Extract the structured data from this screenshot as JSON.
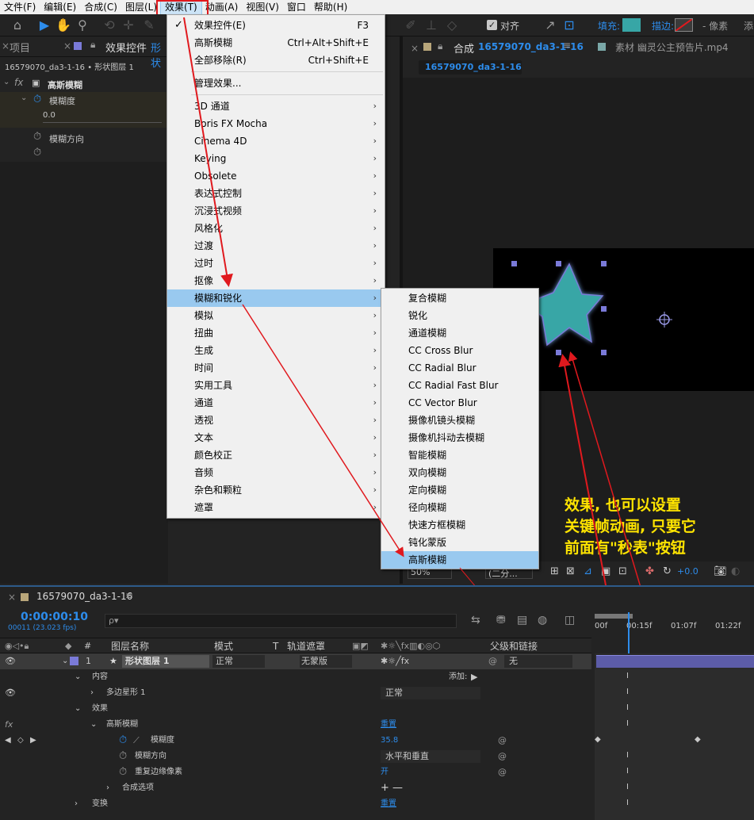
{
  "menubar": {
    "items": [
      "文件(F)",
      "编辑(E)",
      "合成(C)",
      "图层(L)",
      "效果(T)",
      "动画(A)",
      "视图(V)",
      "窗口",
      "帮助(H)"
    ]
  },
  "toolbar": {
    "align_label": "对齐",
    "fill_label": "填充:",
    "stroke_label": "描边:",
    "stroke_unit": "- 像素",
    "add_label": "添"
  },
  "left_panel": {
    "tab_project": "项目",
    "tab_effect_controls": "效果控件",
    "tab_layer": "形状",
    "breadcrumb": "16579070_da3-1-16 • 形状图层 1",
    "effect_name": "高斯模糊",
    "blurriness_label": "模糊度",
    "blurriness_value": "0.0",
    "dimension_label": "模糊方向"
  },
  "comp_panel": {
    "tab_label": "合成",
    "comp_name": "16579070_da3-1-16",
    "footage_tab": "素材 幽灵公主预告片.mp4",
    "sub_tab": "16579070_da3-1-16",
    "zoom": "50%",
    "resolution": "(二分...",
    "exposure": "+0.0"
  },
  "effect_menu": {
    "items": [
      {
        "label": "效果控件(E)",
        "shortcut": "F3",
        "checked": true
      },
      {
        "label": "高斯模糊",
        "shortcut": "Ctrl+Alt+Shift+E"
      },
      {
        "label": "全部移除(R)",
        "shortcut": "Ctrl+Shift+E"
      }
    ],
    "manage": "管理效果...",
    "categories": [
      "3D 通道",
      "Boris FX Mocha",
      "Cinema 4D",
      "Keying",
      "Obsolete",
      "表达式控制",
      "沉浸式视频",
      "风格化",
      "过渡",
      "过时",
      "抠像",
      "模糊和锐化",
      "模拟",
      "扭曲",
      "生成",
      "时间",
      "实用工具",
      "通道",
      "透视",
      "文本",
      "颜色校正",
      "音频",
      "杂色和颗粒",
      "遮罩"
    ]
  },
  "blur_submenu": {
    "items": [
      "复合模糊",
      "锐化",
      "通道模糊",
      "CC Cross Blur",
      "CC Radial Blur",
      "CC Radial Fast Blur",
      "CC Vector Blur",
      "摄像机镜头模糊",
      "摄像机抖动去模糊",
      "智能模糊",
      "双向模糊",
      "定向模糊",
      "径向模糊",
      "快速方框模糊",
      "钝化蒙版",
      "高斯模糊"
    ]
  },
  "annotation": {
    "line1": "效果, 也可以设置",
    "line2": "关键帧动画, 只要它",
    "line3": "前面有\"秒表\"按钮"
  },
  "timeline": {
    "comp_tab": "16579070_da3-1-16",
    "timecode": "0:00:00:10",
    "frame_info": "00011 (23.023 fps)",
    "search_placeholder": "ρ▾",
    "col_num": "#",
    "col_layer_name": "图层名称",
    "col_mode": "模式",
    "col_t": "T",
    "col_trkmat": "轨道遮罩",
    "col_parent": "父级和链接",
    "ruler": [
      "00f",
      "00:15f",
      "01:07f",
      "01:22f"
    ],
    "layer_number": "1",
    "layer_name": "形状图层 1",
    "layer_mode": "正常",
    "layer_matte": "无蒙版",
    "layer_parent": "无",
    "contents_label": "内容",
    "add_label": "添加:",
    "polystar_label": "多边星形 1",
    "polystar_mode": "正常",
    "effects_label": "效果",
    "gauss_label": "高斯模糊",
    "reset_label": "重置",
    "blurriness_label": "模糊度",
    "blurriness_value": "35.8",
    "dimension_label": "模糊方向",
    "dimension_value": "水平和垂直",
    "repeat_edge_label": "重复边缘像素",
    "repeat_edge_value": "开",
    "compositing_label": "合成选项",
    "compositing_value": "+ —",
    "transform_label": "变换",
    "transform_reset": "重置"
  },
  "colors": {
    "accent_blue": "#2d8ceb",
    "annotation_yellow": "#ffe400",
    "highlight_red": "#e0191e",
    "menu_highlight": "#99c9ef",
    "star_fill": "#37a6a6"
  }
}
